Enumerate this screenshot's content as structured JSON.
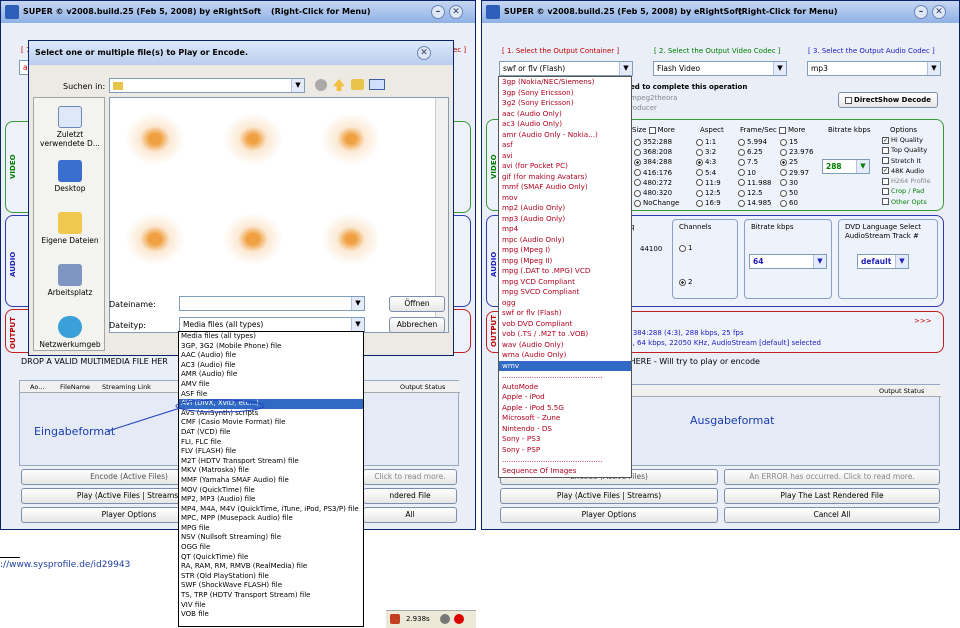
{
  "left_window": {
    "title": "SUPER © v2008.build.25 (Feb 5, 2008) by eRightSoft",
    "right_click": "(Right-Click for Menu)",
    "header_red": "[ 1",
    "header_right": "ec ]",
    "combo_value": "avi",
    "section_video": "VIDEO",
    "section_audio": "AUDIO",
    "section_output": "OUTPUT",
    "drop_text": "DROP A VALID MULTIMEDIA FILE HER",
    "col_a": "Ao...",
    "col_filename": "FileName",
    "col_streaming": "Streaming Link",
    "col_status": "Output Status",
    "btn_encode": "Encode (Active Files)",
    "btn_read_more": "Click to read more.",
    "btn_play": "Play (Active Files | Streams)",
    "btn_rendered": "ndered File",
    "btn_player": "Player Options",
    "btn_all": "All",
    "callout": "Eingabeformat"
  },
  "dialog": {
    "title": "Select one or multiple file(s) to Play or Encode.",
    "look_in_label": "Suchen in:",
    "places": [
      "Zuletzt verwendete D...",
      "Desktop",
      "Eigene Dateien",
      "Arbeitsplatz",
      "Netzwerkumgeb"
    ],
    "filename_label": "Dateiname:",
    "filetype_label": "Dateityp:",
    "filetype_value": "Media files (all types)",
    "open_button": "Öffnen",
    "cancel_button": "Abbrechen",
    "filetypes": [
      "Media files (all types)",
      "3GP, 3G2 (Mobile Phone) file",
      "AAC (Audio) file",
      "AC3 (Audio) file",
      "AMR (Audio) file",
      "AMV file",
      "ASF file",
      "AVI (DivX, XviD, etc...)",
      "AVS (AviSynth) scripts",
      "CMF (Casio Movie Format) file",
      "DAT (VCD) file",
      "FLI, FLC file",
      "FLV (FLASH) file",
      "M2T (HDTV Transport Stream) file",
      "MKV (Matroska) file",
      "MMF (Yamaha SMAF Audio) file",
      "MOV (QuickTime) file",
      "MP2, MP3 (Audio) file",
      "MP4, M4A, M4V (QuickTime, iTune, iPod, PS3/P) file",
      "MPC, MPP (Musepack Audio) file",
      "MPG file",
      "NSV (Nullsoft Streaming) file",
      "OGG file",
      "QT (QuickTime) file",
      "RA, RAM, RM, RMVB (RealMedia) file",
      "STR (Old PlayStation) file",
      "SWF (ShockWave FLASH) file",
      "TS, TRP (HDTV Transport Stream) file",
      "VIV file",
      "VOB file"
    ],
    "selected_index": 7
  },
  "right_window": {
    "title": "SUPER © v2008.build.25 (Feb 5, 2008) by eRightSoft",
    "right_click": "(Right-Click for Menu)",
    "hdr1": "[ 1.      Select the Output Container ]",
    "hdr2": "[ 2.   Select the Output Video Codec ]",
    "hdr3": "[ 3.   Select the Output Audio Codec ]",
    "container_value": "swf or flv (Flash)",
    "video_codec_value": "Flash Video",
    "audio_codec_value": "mp3",
    "complete_text": "ed to complete this operation",
    "mpeg_text": "mpeg2theora",
    "producer_text": "roducer",
    "directshow": "DirectShow Decode",
    "size_label": "Size",
    "more_label": "More",
    "sizes": [
      "352:288",
      "368:208",
      "384:288",
      "416:176",
      "480:272",
      "480:320",
      "NoChange"
    ],
    "aspect_label": "Aspect",
    "aspects": [
      "1:1",
      "3:2",
      "4:3",
      "5:4",
      "11:9",
      "12:5",
      "16:9"
    ],
    "fps_label": "Frame/Sec",
    "fps_more": "More",
    "fps_a": [
      "5.994",
      "6.25",
      "7.5",
      "10",
      "11.988",
      "12.5",
      "14.985"
    ],
    "fps_b": [
      "15",
      "23.976",
      "25",
      "29.97",
      "30",
      "50",
      "60"
    ],
    "bitrate_label": "Bitrate  kbps",
    "bitrate_value": "288",
    "options_label": "Options",
    "options": [
      "Hi Quality",
      "Top Quality",
      "Stretch It",
      "48K Audio",
      "H264 Profile",
      "Crop / Pad",
      "Other Opts"
    ],
    "samp_label": "q",
    "samp_value": "44100",
    "channels_label": "Channels",
    "ch1": "1",
    "ch2": "2",
    "abitrate_label": "Bitrate  kbps",
    "abitrate_value": "64",
    "dvd_label": "DVD Language Select",
    "dvd_track": "AudioStream  Track #",
    "dvd_value": "default",
    "out_arrows": ">>>",
    "out_line1": "o, 384:288 (4:3),  288 kbps,  25 fps",
    "out_line2": "eo,  64 kbps,  22050 KHz,  AudioStream [default] selected",
    "drop_text": "E HERE - Will try to play or encode",
    "col_status": "Output Status",
    "btn_encode": "Encode (Active Files)",
    "btn_error": "An ERROR has occurred.  Click to read more.",
    "btn_play": "Play (Active Files | Streams)",
    "btn_last": "Play The Last Rendered File",
    "btn_player": "Player Options",
    "btn_cancel": "Cancel All",
    "callout": "Ausgabeformat"
  },
  "containers": [
    "3gp  (Nokia/NEC/Siemens)",
    "3gp  (Sony Ericsson)",
    "3g2  (Sony Ericsson)",
    "aac  (Audio Only)",
    "ac3  (Audio Only)",
    "amr (Audio Only - Nokia...)",
    "asf",
    "avi",
    "avi  (for Pocket PC)",
    "gif  (for making Avatars)",
    "mmf  (SMAF Audio Only)",
    "mov",
    "mp2  (Audio Only)",
    "mp3  (Audio Only)",
    "mp4",
    "mpc  (Audio Only)",
    "mpg  (Mpeg I)",
    "mpg  (Mpeg II)",
    "mpg  (.DAT to .MPG) VCD",
    "mpg  VCD Compliant",
    "mpg  SVCD Compliant",
    "ogg",
    "swf or flv (Flash)",
    "vob  DVD Compliant",
    "vob  (.TS / .M2T to .VOB)",
    "wav (Audio Only)",
    "wma (Audio Only)",
    "wmv",
    "............................................",
    "AutoMode",
    "Apple - iPod",
    "Apple - iPod 5.5G",
    "Microsoft - Zune",
    "Nintendo - DS",
    "Sony - PS3",
    "Sony - PSP",
    "............................................",
    "Sequence Of Images"
  ],
  "highlighted_container": 27,
  "footer": {
    "url": "://www.sysprofile.de/id29943",
    "timer": "2.938s"
  }
}
